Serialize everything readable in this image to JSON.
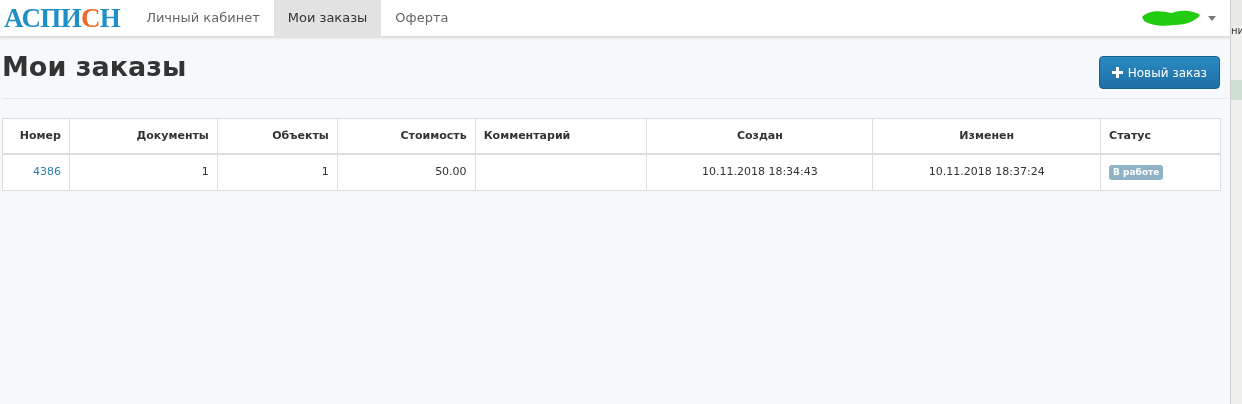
{
  "brand": {
    "before": "АСПИ",
    "accent": "С",
    "after": "Н"
  },
  "tabs": [
    {
      "label": "Личный кабинет",
      "selected": false
    },
    {
      "label": "Мои заказы",
      "selected": true
    },
    {
      "label": "Оферта",
      "selected": false
    }
  ],
  "page_title": "Мои заказы",
  "new_order_button": "Новый заказ",
  "table": {
    "columns": [
      "Номер",
      "Документы",
      "Объекты",
      "Стоимость",
      "Комментарий",
      "Создан",
      "Изменен",
      "Статус"
    ],
    "rows": [
      {
        "number": "4386",
        "documents": "1",
        "objects": "1",
        "cost": "50.00",
        "created": "10.11.2018 18:34:43",
        "modified": "10.11.2018 18:37:24",
        "status": "В работе"
      }
    ]
  },
  "side_window": {
    "fragment": "ни"
  }
}
